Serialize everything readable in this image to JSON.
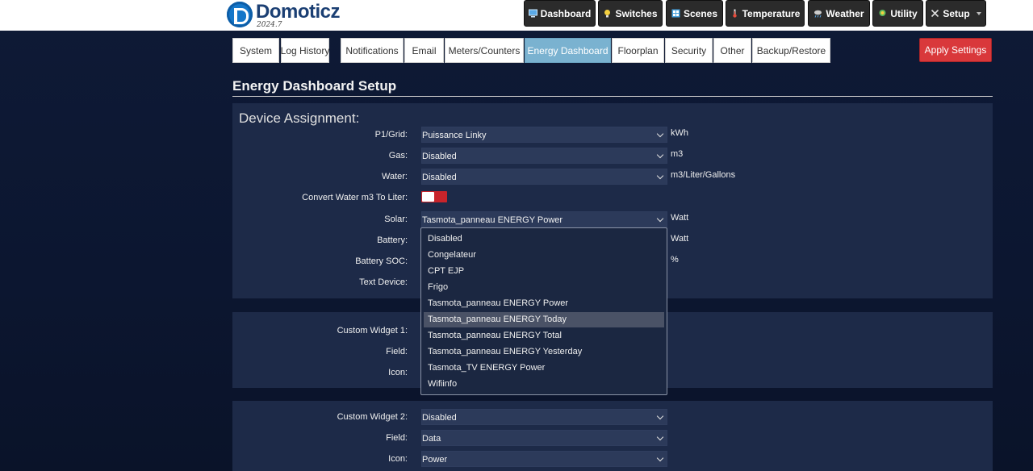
{
  "brand": {
    "name": "Domoticz",
    "version": "2024.7"
  },
  "nav": [
    {
      "label": "Dashboard",
      "icon": "monitor-icon"
    },
    {
      "label": "Switches",
      "icon": "bulb-icon"
    },
    {
      "label": "Scenes",
      "icon": "scenes-icon"
    },
    {
      "label": "Temperature",
      "icon": "thermometer-icon"
    },
    {
      "label": "Weather",
      "icon": "weather-icon"
    },
    {
      "label": "Utility",
      "icon": "utility-icon"
    },
    {
      "label": "Setup",
      "icon": "tools-icon"
    }
  ],
  "tabs": [
    "System",
    "Log History",
    "Notifications",
    "Email",
    "Meters/Counters",
    "Energy Dashboard",
    "Floorplan",
    "Security",
    "Other",
    "Backup/Restore"
  ],
  "active_tab": "Energy Dashboard",
  "apply_label": "Apply Settings",
  "page_title": "Energy Dashboard Setup",
  "device_assignment": {
    "heading": "Device Assignment:",
    "rows": [
      {
        "label": "P1/Grid:",
        "value": "Puissance Linky",
        "unit": "kWh"
      },
      {
        "label": "Gas:",
        "value": "Disabled",
        "unit": "m3"
      },
      {
        "label": "Water:",
        "value": "Disabled",
        "unit": "m3/Liter/Gallons"
      },
      {
        "label": "Convert Water m3 To Liter:",
        "value": "",
        "unit": ""
      },
      {
        "label": "Solar:",
        "value": "Tasmota_panneau ENERGY Power",
        "unit": "Watt"
      },
      {
        "label": "Battery:",
        "value": "",
        "unit": "Watt"
      },
      {
        "label": "Battery SOC:",
        "value": "",
        "unit": "%"
      },
      {
        "label": "Text Device:",
        "value": "",
        "unit": ""
      }
    ]
  },
  "solar_dropdown": {
    "options": [
      "Disabled",
      "Congelateur",
      "CPT EJP",
      "Frigo",
      "Tasmota_panneau ENERGY Power",
      "Tasmota_panneau ENERGY Today",
      "Tasmota_panneau ENERGY Total",
      "Tasmota_panneau ENERGY Yesterday",
      "Tasmota_TV ENERGY Power",
      "Wifiinfo"
    ],
    "highlighted": "Tasmota_panneau ENERGY Today"
  },
  "custom_widget_1": {
    "rows": [
      {
        "label": "Custom Widget 1:"
      },
      {
        "label": "Field:"
      },
      {
        "label": "Icon:"
      }
    ]
  },
  "custom_widget_2": {
    "rows": [
      {
        "label": "Custom Widget 2:",
        "value": "Disabled"
      },
      {
        "label": "Field:",
        "value": "Data"
      },
      {
        "label": "Icon:",
        "value": "Power"
      }
    ]
  }
}
